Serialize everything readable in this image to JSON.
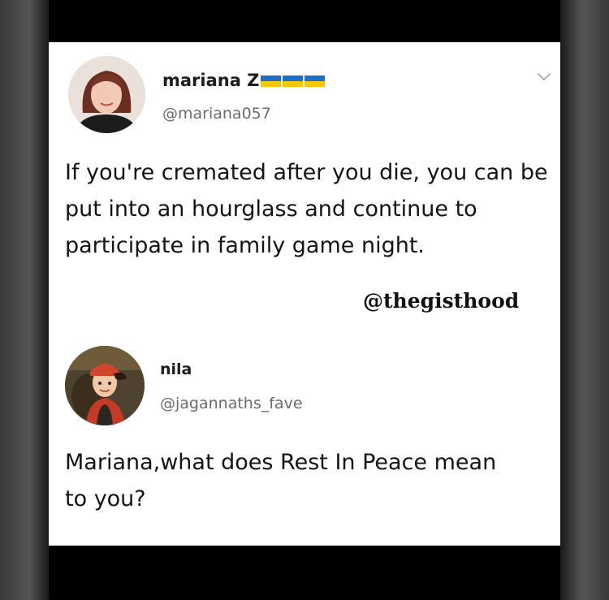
{
  "post": {
    "author_name": "mariana Z",
    "author_handle": "@mariana057",
    "flag_icons": [
      "ukraine-flag-icon",
      "ukraine-flag-icon",
      "ukraine-flag-icon"
    ],
    "text": "If you're cremated after you die, you can be put into an hourglass and continue to participate in family game night."
  },
  "watermark": "@thegisthood",
  "reply": {
    "author_name": "nila",
    "author_handle": "@jagannaths_fave",
    "text": "Mariana,what does Rest In Peace mean to you?"
  },
  "colors": {
    "card": "#ffffff",
    "frame": "#000000",
    "handle": "#6b6b6b",
    "flag_blue": "#1f6fc9",
    "flag_yellow": "#f5c800"
  }
}
